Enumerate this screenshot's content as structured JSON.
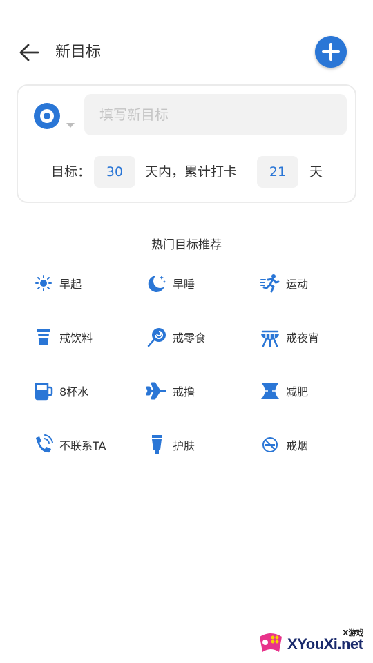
{
  "header": {
    "title": "新目标",
    "back_icon": "arrow-left-icon",
    "add_icon": "plus-icon"
  },
  "colors": {
    "accent": "#2a76d6",
    "input_bg": "#f2f2f2",
    "card_border": "#ebebeb",
    "placeholder": "#c4c4c4"
  },
  "goal_card": {
    "type_icon": "target-icon",
    "input_placeholder": "填写新目标",
    "input_value": "",
    "prefix_label": "目标：",
    "days_value": "30",
    "middle_label": "天内，累计打卡",
    "checkin_value": "21",
    "suffix_label": "天"
  },
  "recommend": {
    "title": "热门目标推荐",
    "items": [
      {
        "label": "早起",
        "icon": "sun-icon"
      },
      {
        "label": "早睡",
        "icon": "moon-stars-icon"
      },
      {
        "label": "运动",
        "icon": "running-icon"
      },
      {
        "label": "戒饮料",
        "icon": "drink-cup-icon"
      },
      {
        "label": "戒零食",
        "icon": "lollipop-icon"
      },
      {
        "label": "戒夜宵",
        "icon": "grill-icon"
      },
      {
        "label": "8杯水",
        "icon": "water-mug-icon"
      },
      {
        "label": "戒撸",
        "icon": "airplane-icon"
      },
      {
        "label": "减肥",
        "icon": "waist-icon"
      },
      {
        "label": "不联系TA",
        "icon": "phone-ring-icon"
      },
      {
        "label": "护肤",
        "icon": "skincare-tube-icon"
      },
      {
        "label": "戒烟",
        "icon": "no-smoking-icon"
      }
    ]
  },
  "watermark": {
    "small_text": "X游戏",
    "big_text": "XYouXi.net"
  }
}
